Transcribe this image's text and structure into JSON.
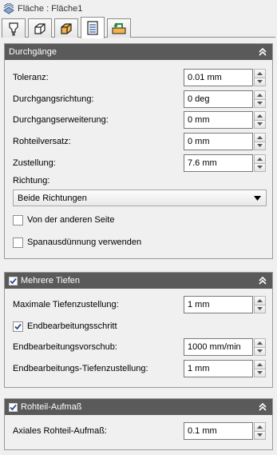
{
  "title": "Fläche : Fläche1",
  "tabs": [
    "tool",
    "shape",
    "box",
    "passes",
    "linking"
  ],
  "passes_panel": {
    "header": "Durchgänge",
    "tolerance_label": "Toleranz:",
    "tolerance_value": "0.01 mm",
    "direction_label": "Durchgangsrichtung:",
    "direction_value": "0 deg",
    "extension_label": "Durchgangserweiterung:",
    "extension_value": "0 mm",
    "stock_offset_label": "Rohteilversatz:",
    "stock_offset_value": "0 mm",
    "stepover_label": "Zustellung:",
    "stepover_value": "7.6 mm",
    "dir_select_label": "Richtung:",
    "dir_select_value": "Beide Richtungen",
    "other_side_label": "Von der anderen Seite",
    "other_side_checked": false,
    "thinning_label": "Spanausdünnung verwenden",
    "thinning_checked": false
  },
  "depths_panel": {
    "header": "Mehrere Tiefen",
    "enabled": true,
    "max_step_label": "Maximale Tiefenzustellung:",
    "max_step_value": "1 mm",
    "finish_label": "Endbearbeitungsschritt",
    "finish_checked": true,
    "finish_feed_label": "Endbearbeitungsvorschub:",
    "finish_feed_value": "1000 mm/min",
    "finish_step_label": "Endbearbeitungs-Tiefenzustellung:",
    "finish_step_value": "1 mm"
  },
  "stock_panel": {
    "header": "Rohteil-Aufmaß",
    "enabled": true,
    "axial_label": "Axiales Rohteil-Aufmaß:",
    "axial_value": "0.1 mm"
  }
}
